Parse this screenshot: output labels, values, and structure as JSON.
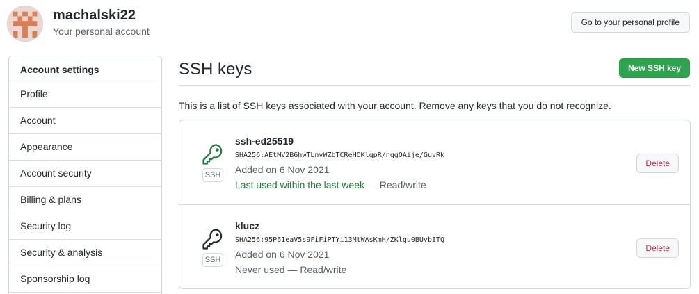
{
  "user": {
    "username": "machalski22",
    "subtitle": "Your personal account",
    "profile_button": "Go to your personal profile"
  },
  "sidebar": {
    "items": [
      {
        "label": "Account settings"
      },
      {
        "label": "Profile"
      },
      {
        "label": "Account"
      },
      {
        "label": "Appearance"
      },
      {
        "label": "Account security"
      },
      {
        "label": "Billing & plans"
      },
      {
        "label": "Security log"
      },
      {
        "label": "Security & analysis"
      },
      {
        "label": "Sponsorship log"
      }
    ]
  },
  "main": {
    "title": "SSH keys",
    "new_button": "New SSH key",
    "description": "This is a list of SSH keys associated with your account. Remove any keys that you do not recognize."
  },
  "keys": [
    {
      "name": "ssh-ed25519",
      "fingerprint": "SHA256:AEtMV2B6hwTLnvWZbTCReHOKlqpR/nqgOAije/GuvRk",
      "added": "Added on 6 Nov 2021",
      "last_used": "Last used within the last week",
      "access": " — Read/write",
      "badge": "SSH",
      "delete": "Delete",
      "icon": "key-icon",
      "icon_color": "#1a7f37"
    },
    {
      "name": "klucz",
      "fingerprint": "SHA256:95P61eaV5s9FiFiPTYi13MtWAsKmH/ZKlqu0BUvbITQ",
      "added": "Added on 6 Nov 2021",
      "last_used": "Never used",
      "access": " — Read/write",
      "badge": "SSH",
      "delete": "Delete",
      "icon": "key-icon",
      "icon_color": "#24292f"
    }
  ],
  "colors": {
    "primary_button": "#2da44e",
    "danger": "#cf222e",
    "success_text": "#1a7f37",
    "border": "#d0d7de"
  }
}
